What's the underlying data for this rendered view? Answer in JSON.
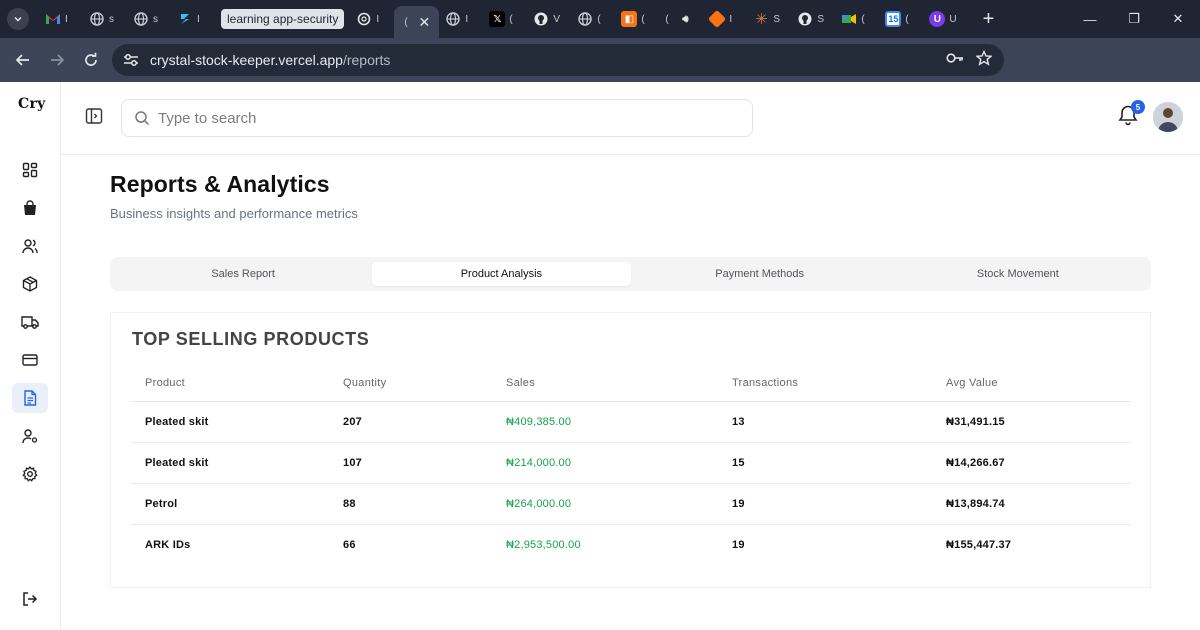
{
  "browser": {
    "tab_tooltip": "learning app-security",
    "url_host": "crystal-stock-keeper.vercel.app",
    "url_path": "/reports",
    "tabs": [
      {
        "icon": "gmail-icon",
        "label": "I"
      },
      {
        "icon": "globe-icon",
        "label": "s"
      },
      {
        "icon": "globe-icon",
        "label": "s"
      },
      {
        "icon": "stack-icon",
        "label": "I"
      },
      {
        "icon": "openai-icon",
        "label": "I"
      },
      {
        "icon": "active-tab",
        "label": "("
      },
      {
        "icon": "globe-icon",
        "label": "I"
      },
      {
        "icon": "x-icon",
        "label": "("
      },
      {
        "icon": "github-icon",
        "label": "V"
      },
      {
        "icon": "globe-icon",
        "label": "("
      },
      {
        "icon": "orange-icon",
        "label": "("
      },
      {
        "icon": "audio-tab",
        "label": "("
      },
      {
        "icon": "cube-icon",
        "label": "I"
      },
      {
        "icon": "claude-icon",
        "label": "S"
      },
      {
        "icon": "github-icon",
        "label": "S"
      },
      {
        "icon": "meet-icon",
        "label": "("
      },
      {
        "icon": "calendar-icon",
        "label": "("
      },
      {
        "icon": "proton-icon",
        "label": "U"
      }
    ]
  },
  "app": {
    "logo": "Cry",
    "search_placeholder": "Type to search",
    "notification_count": "5"
  },
  "page": {
    "title": "Reports & Analytics",
    "subtitle": "Business insights and performance metrics",
    "tabs": [
      "Sales Report",
      "Product Analysis",
      "Payment Methods",
      "Stock Movement"
    ],
    "active_tab": "Product Analysis"
  },
  "report": {
    "title": "TOP SELLING PRODUCTS",
    "columns": [
      "Product",
      "Quantity",
      "Sales",
      "Transactions",
      "Avg Value"
    ],
    "rows": [
      {
        "product": "Pleated skit",
        "quantity": "207",
        "sales": "₦409,385.00",
        "transactions": "13",
        "avg_value": "₦31,491.15"
      },
      {
        "product": "Pleated skit",
        "quantity": "107",
        "sales": "₦214,000.00",
        "transactions": "15",
        "avg_value": "₦14,266.67"
      },
      {
        "product": "Petrol",
        "quantity": "88",
        "sales": "₦264,000.00",
        "transactions": "19",
        "avg_value": "₦13,894.74"
      },
      {
        "product": "ARK IDs",
        "quantity": "66",
        "sales": "₦2,953,500.00",
        "transactions": "19",
        "avg_value": "₦155,447.37"
      }
    ]
  },
  "colors": {
    "accent": "#2563eb",
    "sales_green": "#16a34a",
    "chrome_dark": "#1f2532",
    "chrome_bar": "#3b4557"
  }
}
